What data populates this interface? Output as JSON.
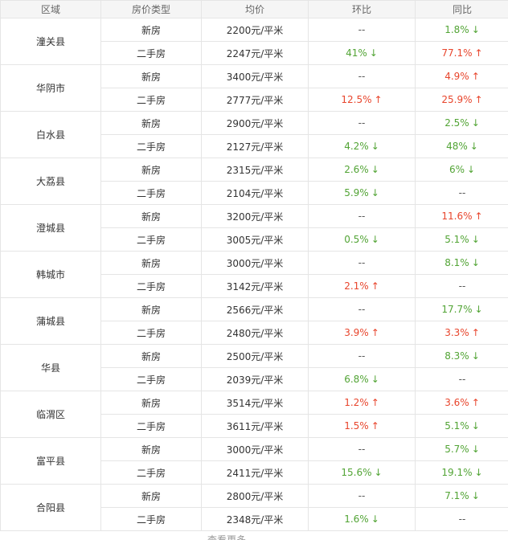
{
  "headers": [
    "区域",
    "房价类型",
    "均价",
    "环比",
    "同比"
  ],
  "colors": {
    "up": "#e8452c",
    "down": "#52a435",
    "flat": "#555555"
  },
  "arrows": {
    "up": "↑",
    "down": "↓"
  },
  "regions": [
    {
      "name": "潼关县",
      "rows": [
        {
          "type": "新房",
          "price": "2200元/平米",
          "mom": "--",
          "mom_dir": "flat",
          "yoy": "1.8%",
          "yoy_dir": "down"
        },
        {
          "type": "二手房",
          "price": "2247元/平米",
          "mom": "41%",
          "mom_dir": "down",
          "yoy": "77.1%",
          "yoy_dir": "up"
        }
      ]
    },
    {
      "name": "华阴市",
      "rows": [
        {
          "type": "新房",
          "price": "3400元/平米",
          "mom": "--",
          "mom_dir": "flat",
          "yoy": "4.9%",
          "yoy_dir": "up"
        },
        {
          "type": "二手房",
          "price": "2777元/平米",
          "mom": "12.5%",
          "mom_dir": "up",
          "yoy": "25.9%",
          "yoy_dir": "up"
        }
      ]
    },
    {
      "name": "白水县",
      "rows": [
        {
          "type": "新房",
          "price": "2900元/平米",
          "mom": "--",
          "mom_dir": "flat",
          "yoy": "2.5%",
          "yoy_dir": "down"
        },
        {
          "type": "二手房",
          "price": "2127元/平米",
          "mom": "4.2%",
          "mom_dir": "down",
          "yoy": "48%",
          "yoy_dir": "down"
        }
      ]
    },
    {
      "name": "大荔县",
      "rows": [
        {
          "type": "新房",
          "price": "2315元/平米",
          "mom": "2.6%",
          "mom_dir": "down",
          "yoy": "6%",
          "yoy_dir": "down"
        },
        {
          "type": "二手房",
          "price": "2104元/平米",
          "mom": "5.9%",
          "mom_dir": "down",
          "yoy": "--",
          "yoy_dir": "flat"
        }
      ]
    },
    {
      "name": "澄城县",
      "rows": [
        {
          "type": "新房",
          "price": "3200元/平米",
          "mom": "--",
          "mom_dir": "flat",
          "yoy": "11.6%",
          "yoy_dir": "up"
        },
        {
          "type": "二手房",
          "price": "3005元/平米",
          "mom": "0.5%",
          "mom_dir": "down",
          "yoy": "5.1%",
          "yoy_dir": "down"
        }
      ]
    },
    {
      "name": "韩城市",
      "rows": [
        {
          "type": "新房",
          "price": "3000元/平米",
          "mom": "--",
          "mom_dir": "flat",
          "yoy": "8.1%",
          "yoy_dir": "down"
        },
        {
          "type": "二手房",
          "price": "3142元/平米",
          "mom": "2.1%",
          "mom_dir": "up",
          "yoy": "--",
          "yoy_dir": "flat"
        }
      ]
    },
    {
      "name": "蒲城县",
      "rows": [
        {
          "type": "新房",
          "price": "2566元/平米",
          "mom": "--",
          "mom_dir": "flat",
          "yoy": "17.7%",
          "yoy_dir": "down"
        },
        {
          "type": "二手房",
          "price": "2480元/平米",
          "mom": "3.9%",
          "mom_dir": "up",
          "yoy": "3.3%",
          "yoy_dir": "up"
        }
      ]
    },
    {
      "name": "华县",
      "rows": [
        {
          "type": "新房",
          "price": "2500元/平米",
          "mom": "--",
          "mom_dir": "flat",
          "yoy": "8.3%",
          "yoy_dir": "down"
        },
        {
          "type": "二手房",
          "price": "2039元/平米",
          "mom": "6.8%",
          "mom_dir": "down",
          "yoy": "--",
          "yoy_dir": "flat"
        }
      ]
    },
    {
      "name": "临渭区",
      "rows": [
        {
          "type": "新房",
          "price": "3514元/平米",
          "mom": "1.2%",
          "mom_dir": "up",
          "yoy": "3.6%",
          "yoy_dir": "up"
        },
        {
          "type": "二手房",
          "price": "3611元/平米",
          "mom": "1.5%",
          "mom_dir": "up",
          "yoy": "5.1%",
          "yoy_dir": "down"
        }
      ]
    },
    {
      "name": "富平县",
      "rows": [
        {
          "type": "新房",
          "price": "3000元/平米",
          "mom": "--",
          "mom_dir": "flat",
          "yoy": "5.7%",
          "yoy_dir": "down"
        },
        {
          "type": "二手房",
          "price": "2411元/平米",
          "mom": "15.6%",
          "mom_dir": "down",
          "yoy": "19.1%",
          "yoy_dir": "down"
        }
      ]
    },
    {
      "name": "合阳县",
      "rows": [
        {
          "type": "新房",
          "price": "2800元/平米",
          "mom": "--",
          "mom_dir": "flat",
          "yoy": "7.1%",
          "yoy_dir": "down"
        },
        {
          "type": "二手房",
          "price": "2348元/平米",
          "mom": "1.6%",
          "mom_dir": "down",
          "yoy": "--",
          "yoy_dir": "flat"
        }
      ]
    }
  ],
  "footer_text": "查看更多"
}
